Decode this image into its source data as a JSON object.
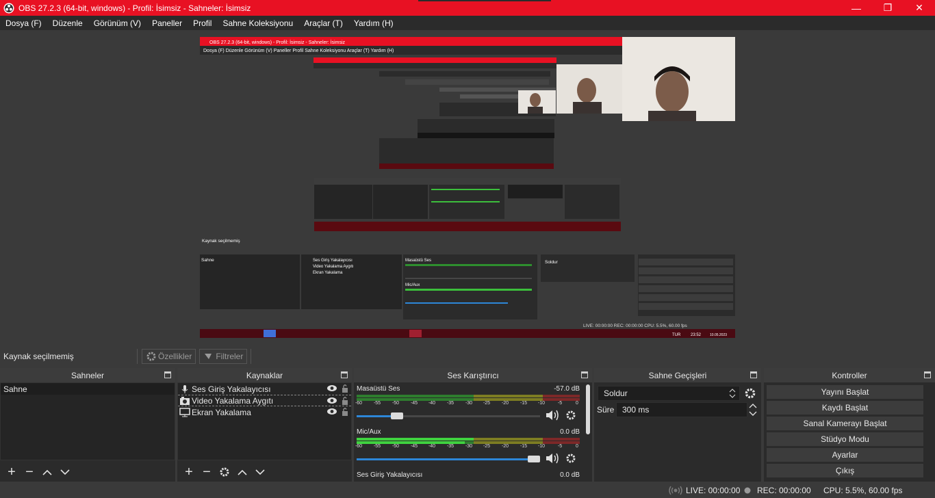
{
  "window": {
    "title": "OBS 27.2.3 (64-bit, windows) - Profil: İsimsiz - Sahneler: İsimsiz",
    "minimize": "—",
    "maximize": "❐",
    "close": "✕"
  },
  "menu": [
    "Dosya (F)",
    "Düzenle",
    "Görünüm (V)",
    "Paneller",
    "Profil",
    "Sahne Koleksiyonu",
    "Araçlar (T)",
    "Yardım (H)"
  ],
  "preview": {
    "inner_title": "OBS 27.2.3 (64-bit, windows) - Profil: İsimsiz - Sahneler: İsimsiz",
    "taskbar_time": "23:52",
    "taskbar_date": "10.05.2023",
    "taskbar_lang": "TUR"
  },
  "source_toolbar": {
    "no_source": "Kaynak seçilmemiş",
    "properties": "Özellikler",
    "filters": "Filtreler"
  },
  "scenes": {
    "title": "Sahneler",
    "items": [
      "Sahne"
    ]
  },
  "sources": {
    "title": "Kaynaklar",
    "items": [
      {
        "name": "Ses Giriş Yakalayıcısı",
        "icon": "microphone-icon"
      },
      {
        "name": "Video Yakalama Aygıtı",
        "icon": "camera-icon"
      },
      {
        "name": "Ekran Yakalama",
        "icon": "monitor-icon"
      }
    ]
  },
  "mixer": {
    "title": "Ses Karıştırıcı",
    "ticks": [
      "-60",
      "-55",
      "-50",
      "-45",
      "-40",
      "-35",
      "-30",
      "-25",
      "-20",
      "-15",
      "-10",
      "-5",
      "0"
    ],
    "channels": [
      {
        "name": "Masaüstü Ses",
        "level": "-57.0 dB",
        "volume": 0.2
      },
      {
        "name": "Mic/Aux",
        "level": "0.0 dB",
        "volume": 1.0
      },
      {
        "name": "Ses Giriş Yakalayıcısı",
        "level": "0.0 dB"
      }
    ]
  },
  "transitions": {
    "title": "Sahne Geçişleri",
    "selected": "Soldur",
    "duration_label": "Süre",
    "duration": "300 ms"
  },
  "controls": {
    "title": "Kontroller",
    "buttons": [
      "Yayını Başlat",
      "Kaydı Başlat",
      "Sanal Kamerayı Başlat",
      "Stüdyo Modu",
      "Ayarlar",
      "Çıkış"
    ]
  },
  "status": {
    "live": "LIVE: 00:00:00",
    "rec": "REC: 00:00:00",
    "cpu": "CPU: 5.5%, 60.00 fps"
  },
  "colors": {
    "title_bar": "#e81123",
    "panel": "#2b2b2b",
    "background": "#3a3a3a",
    "slider": "#2d87d8"
  }
}
